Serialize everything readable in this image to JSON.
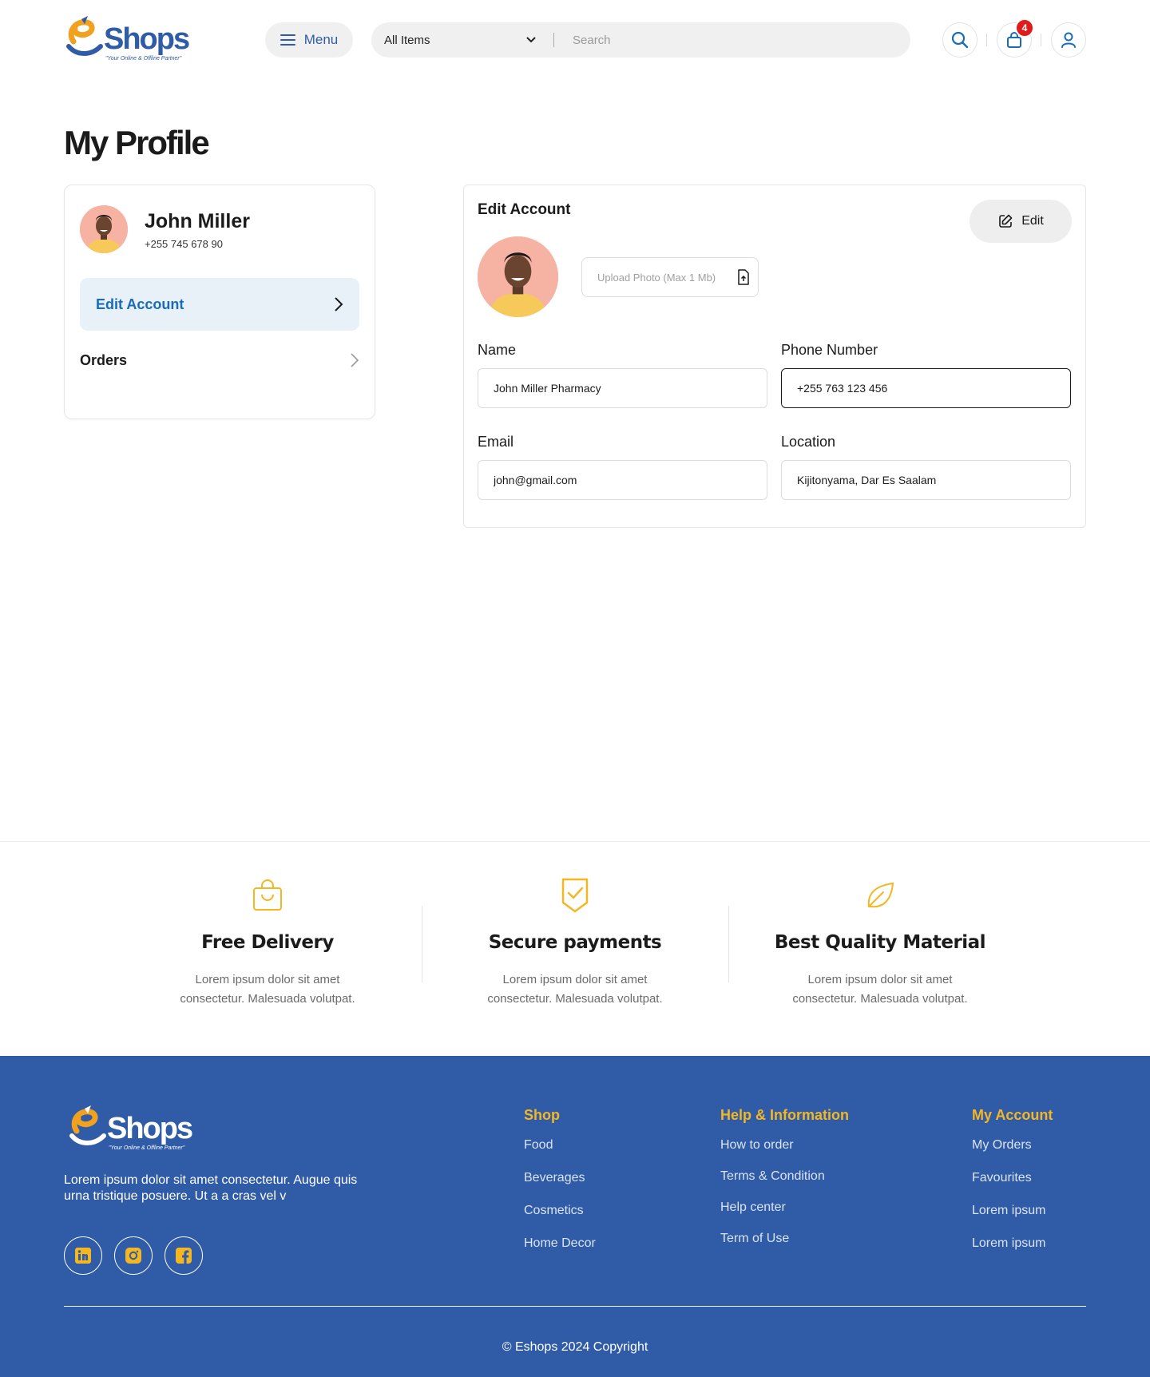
{
  "header": {
    "logo_text": "Shops",
    "logo_tagline": "\"Your Online & Offline Partner\"",
    "menu_label": "Menu",
    "category_selected": "All Items",
    "search_placeholder": "Search",
    "cart_count": "4"
  },
  "page_title": "My Profile",
  "profile": {
    "name": "John Miller",
    "phone": "+255 745 678 90",
    "nav": [
      {
        "label": "Edit Account",
        "active": true
      },
      {
        "label": "Orders",
        "active": false
      }
    ]
  },
  "edit_account": {
    "title": "Edit Account",
    "edit_button": "Edit",
    "upload_label": "Upload Photo (Max 1 Mb)",
    "fields": {
      "name": {
        "label": "Name",
        "value": "John Miller Pharmacy"
      },
      "phone": {
        "label": "Phone Number",
        "value": "+255 763 123 456"
      },
      "email": {
        "label": "Email",
        "value": "john@gmail.com"
      },
      "location": {
        "label": "Location",
        "value": "Kijitonyama, Dar Es Saalam"
      }
    }
  },
  "features": [
    {
      "icon": "shopping-bag-icon",
      "title": "Free Delivery",
      "line1": "Lorem ipsum dolor sit amet",
      "line2": "consectetur. Malesuada volutpat."
    },
    {
      "icon": "shield-check-icon",
      "title": "Secure payments",
      "line1": "Lorem ipsum dolor sit amet",
      "line2": "consectetur. Malesuada volutpat."
    },
    {
      "icon": "leaf-icon",
      "title": "Best Quality Material",
      "line1": "Lorem ipsum dolor sit amet",
      "line2": "consectetur. Malesuada volutpat."
    }
  ],
  "footer": {
    "logo_text": "Shops",
    "logo_tagline": "\"Your Online & Offline Partner\"",
    "description": "Lorem ipsum dolor sit amet consectetur. Augue quis urna tristique posuere. Ut a a cras vel v",
    "social": [
      "linkedin-icon",
      "instagram-icon",
      "facebook-icon"
    ],
    "columns": [
      {
        "title": "Shop",
        "links": [
          "Food",
          "Beverages",
          "Cosmetics",
          "Home Decor"
        ]
      },
      {
        "title": "Help & Information",
        "links": [
          "How to order",
          "Terms & Condition",
          "Help center",
          "Term of  Use"
        ]
      },
      {
        "title": "My Account",
        "links": [
          "My Orders",
          "Favourites",
          "Lorem ipsum",
          "Lorem ipsum"
        ]
      }
    ],
    "copyright": "© Eshops 2024 Copyright"
  },
  "colors": {
    "brand_blue": "#2f5ba7",
    "accent_yellow": "#f4b722",
    "link_blue": "#1a6bb8",
    "badge_red": "#e11b1b"
  }
}
